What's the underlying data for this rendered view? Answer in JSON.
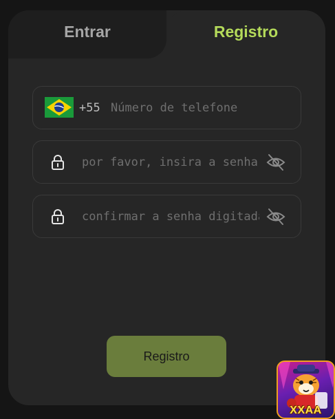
{
  "tabs": {
    "login_label": "Entrar",
    "register_label": "Registro"
  },
  "phone": {
    "country_code": "+55",
    "placeholder": "Número de telefone",
    "flag_icon": "brazil-flag-icon"
  },
  "password": {
    "placeholder": "por favor, insira a senha",
    "lock_icon": "lock-icon",
    "visibility_icon": "eye-off-icon"
  },
  "confirm_password": {
    "placeholder": "confirmar a senha digitada",
    "lock_icon": "lock-icon",
    "visibility_icon": "eye-off-icon"
  },
  "submit": {
    "label": "Registro"
  },
  "badge": {
    "label": "XXAA"
  },
  "colors": {
    "accent_green": "#b4da5a",
    "button_green": "#6a7d3c",
    "card_bg": "#262626",
    "page_bg": "#151515"
  }
}
